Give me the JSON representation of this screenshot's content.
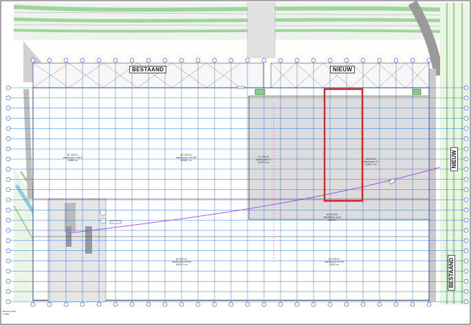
{
  "labels": {
    "bestaand_top": "BESTAAND",
    "nieuw_top": "NIEUW",
    "nieuw_side": "NIEUW",
    "bestaand_side": "BESTAAND"
  },
  "areas": [
    {
      "line1": "B1 G00.01",
      "line2": "warehouse / hall 1",
      "line3": "10880 m²"
    },
    {
      "line1": "B2 G00.01",
      "line2": "warehouse / hall B2",
      "line3": "10956.7 m²"
    },
    {
      "line1": "C1 G00.01",
      "line2": "Warehouse C1",
      "line3": "11327.4 m²"
    },
    {
      "line1": "C2 G0.01",
      "line2": "Warehouse C2",
      "line3": "10295.1 m²"
    },
    {
      "line1": "B3 G00.01",
      "line2": "warehouse unit B3",
      "line3": "18431.0 m²"
    },
    {
      "line1": "B4 G00.01",
      "line2": "warehouse unit B4",
      "line3": "18310 m²"
    },
    {
      "line1": "B4 G0.002",
      "line2": "uitbreiding / zone",
      "line3": "1480 m²"
    }
  ],
  "legend": {
    "line1": "Begane grond",
    "line2": "1:1000"
  },
  "colors": {
    "grid": "#2f6fe0",
    "highlight": "#e02020",
    "greenery": "#c7e8c0",
    "new_area": "#dcdcdc",
    "gas_line": "#a040e0"
  }
}
